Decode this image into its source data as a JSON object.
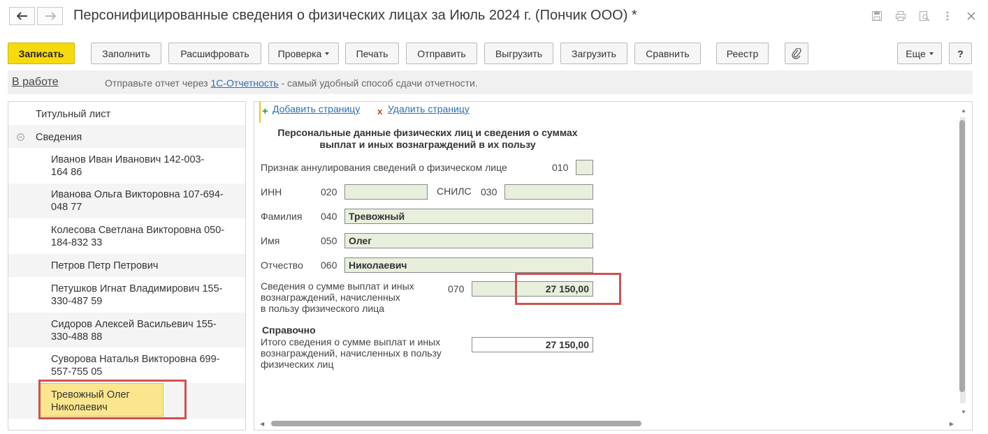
{
  "window": {
    "title": "Персонифицированные сведения о физических лицах за Июль 2024 г. (Пончик ООО) *"
  },
  "toolbar": {
    "save": "Записать",
    "fill": "Заполнить",
    "decode": "Расшифровать",
    "check": "Проверка",
    "print": "Печать",
    "send": "Отправить",
    "export": "Выгрузить",
    "import": "Загрузить",
    "compare": "Сравнить",
    "registry": "Реестр",
    "more": "Еще",
    "help": "?"
  },
  "infobar": {
    "status": "В работе",
    "text_before": "Отправьте отчет через ",
    "link": "1С-Отчетность",
    "text_after": " - самый удобный способ сдачи отчетности."
  },
  "tree": {
    "title_page": "Титульный лист",
    "group": "Сведения",
    "items": [
      "Иванов Иван Иванович 142-003-\n164 86",
      "Иванова Ольга Викторовна 107-694-\n048 77",
      "Колесова Светлана Викторовна 050-\n184-832 33",
      "Петров Петр Петрович",
      "Петушков Игнат Владимирович 155-\n330-487 59",
      "Сидоров Алексей Васильевич 155-\n330-488 88",
      "Суворова Наталья Викторовна 699-\n557-755 05",
      "Тревожный Олег\nНиколаевич"
    ],
    "selected_index": 7
  },
  "form": {
    "add_page": "Добавить страницу",
    "delete_page": "Удалить страницу",
    "heading": "Персональные данные физических лиц и сведения о суммах\nвыплат и иных вознаграждений в их пользу",
    "annul_label": "Признак аннулирования сведений о физическом лице",
    "annul_code": "010",
    "annul_value": "",
    "inn_label": "ИНН",
    "inn_code": "020",
    "inn_value": "",
    "snils_label": "СНИЛС",
    "snils_code": "030",
    "snils_value": "",
    "lastname_label": "Фамилия",
    "lastname_code": "040",
    "lastname_value": "Тревожный",
    "firstname_label": "Имя",
    "firstname_code": "050",
    "firstname_value": "Олег",
    "patronymic_label": "Отчество",
    "patronymic_code": "060",
    "patronymic_value": "Николаевич",
    "payments_label": "Сведения о сумме выплат и иных\nвознаграждений, начисленных\nв пользу физического лица",
    "payments_code": "070",
    "payments_value": "27 150,00",
    "reference_title": "Справочно",
    "total_label": "Итого сведения о сумме выплат и иных\nвознаграждений, начисленных в пользу\nфизических лиц",
    "total_value": "27 150,00"
  },
  "colors": {
    "primary_button": "#f7da0c",
    "field_fill": "#e6f0dd",
    "link": "#2f6db5",
    "highlight_frame": "#d05050",
    "selected_row": "#fbe68e"
  }
}
